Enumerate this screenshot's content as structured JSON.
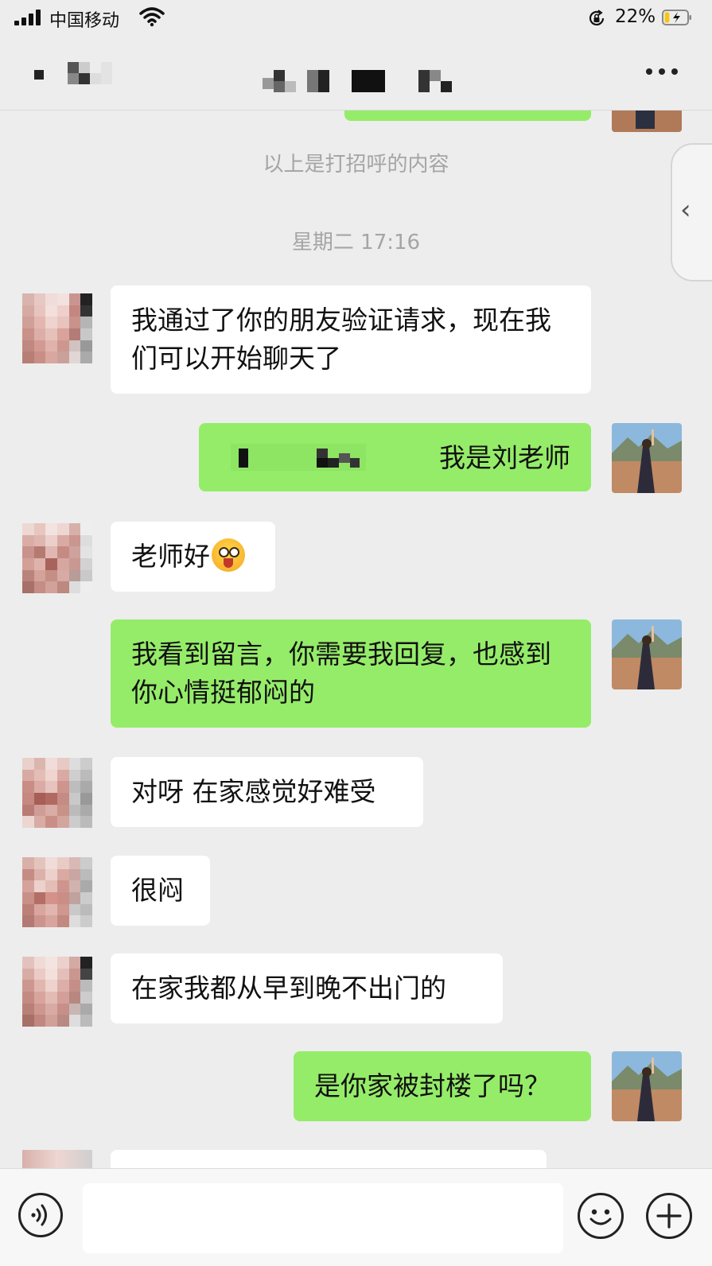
{
  "status_bar": {
    "carrier": "中国移动",
    "battery_percent": "22%",
    "battery_level": 0.22
  },
  "header": {
    "title": "",
    "more_icon": "more-dots-icon"
  },
  "chat": {
    "system_notice": "以上是打招呼的内容",
    "timestamp": "星期二 17:16",
    "messages": [
      {
        "from": "them",
        "text": "我通过了你的朋友验证请求，现在我们可以开始聊天了"
      },
      {
        "from": "me",
        "text": "我是刘老师"
      },
      {
        "from": "them",
        "text": "老师好",
        "emoji": "tongue-out-emoji"
      },
      {
        "from": "me",
        "text": "我看到留言，你需要我回复，也感到你心情挺郁闷的"
      },
      {
        "from": "them",
        "text": "对呀 在家感觉好难受"
      },
      {
        "from": "them",
        "text": "很闷"
      },
      {
        "from": "them",
        "text": "在家我都从早到晚不出门的"
      },
      {
        "from": "me",
        "text": "是你家被封楼了吗？"
      }
    ]
  },
  "input_bar": {
    "voice_icon": "voice-icon",
    "emoji_icon": "smile-icon",
    "plus_icon": "plus-icon",
    "input_value": ""
  },
  "colors": {
    "background": "#ededed",
    "outgoing_bubble": "#95ec69",
    "incoming_bubble": "#ffffff",
    "system_text": "#a5a5a5"
  }
}
